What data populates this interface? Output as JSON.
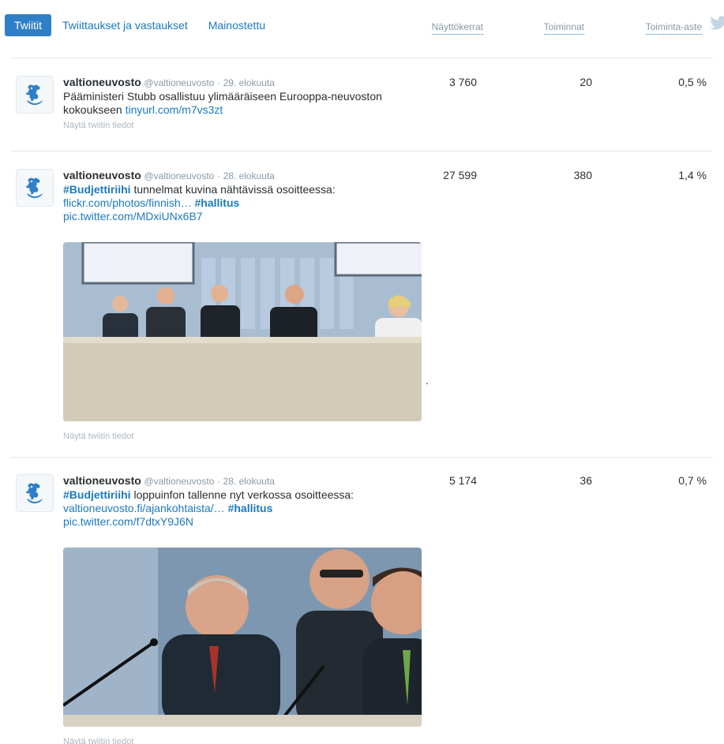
{
  "tabs": [
    {
      "label": "Twiitit",
      "active": true
    },
    {
      "label": "Twiittaukset ja vastaukset",
      "active": false
    },
    {
      "label": "Mainostettu",
      "active": false
    }
  ],
  "metric_headers": {
    "impressions": "Näyttökerrat",
    "engagements": "Toiminnat",
    "engagement_rate": "Toiminta-aste"
  },
  "colors": {
    "accent": "#1b79be",
    "active_tab_bg": "#2f7fc8",
    "muted": "#8899a6",
    "divider": "#e1e8ed"
  },
  "tweets": [
    {
      "author": "valtioneuvosto",
      "handle": "@valtioneuvosto",
      "sep": "·",
      "date": "29. elokuuta",
      "text_plain_1": "Pääministeri Stubb osallistuu ylimääräiseen Eurooppa-neuvoston kokoukseen ",
      "link_1": "tinyurl.com/m7vs3zt",
      "details": "Näytä twiitin tiedot",
      "impressions": "3 760",
      "engagements": "20",
      "engagement_rate": "0,5 %"
    },
    {
      "author": "valtioneuvosto",
      "handle": "@valtioneuvosto",
      "sep": "·",
      "date": "28. elokuuta",
      "hashtag_1": "#Budjettiriihi",
      "text_plain_1": " tunnelmat kuvina nähtävissä osoitteessa:",
      "link_1": "flickr.com/photos/finnish…",
      "hashtag_2": "#hallitus",
      "link_2": "pic.twitter.com/MDxiUNx6B7",
      "details": "Näytä twiitin tiedot",
      "impressions": "27 599",
      "engagements": "380",
      "engagement_rate": "1,4 %",
      "stray_mark": "."
    },
    {
      "author": "valtioneuvosto",
      "handle": "@valtioneuvosto",
      "sep": "·",
      "date": "28. elokuuta",
      "hashtag_1": "#Budjettiriihi",
      "text_plain_1": " loppuinfon tallenne nyt verkossa osoitteessa:",
      "link_1": "valtioneuvosto.fi/ajankohtaista/…",
      "hashtag_2": "#hallitus",
      "link_2": "pic.twitter.com/f7dtxY9J6N",
      "details": "Näytä twiitin tiedot",
      "impressions": "5 174",
      "engagements": "36",
      "engagement_rate": "0,7 %"
    }
  ],
  "icons": {
    "brand": "twitter-bird-icon",
    "avatar": "lion-coat-of-arms-icon"
  }
}
